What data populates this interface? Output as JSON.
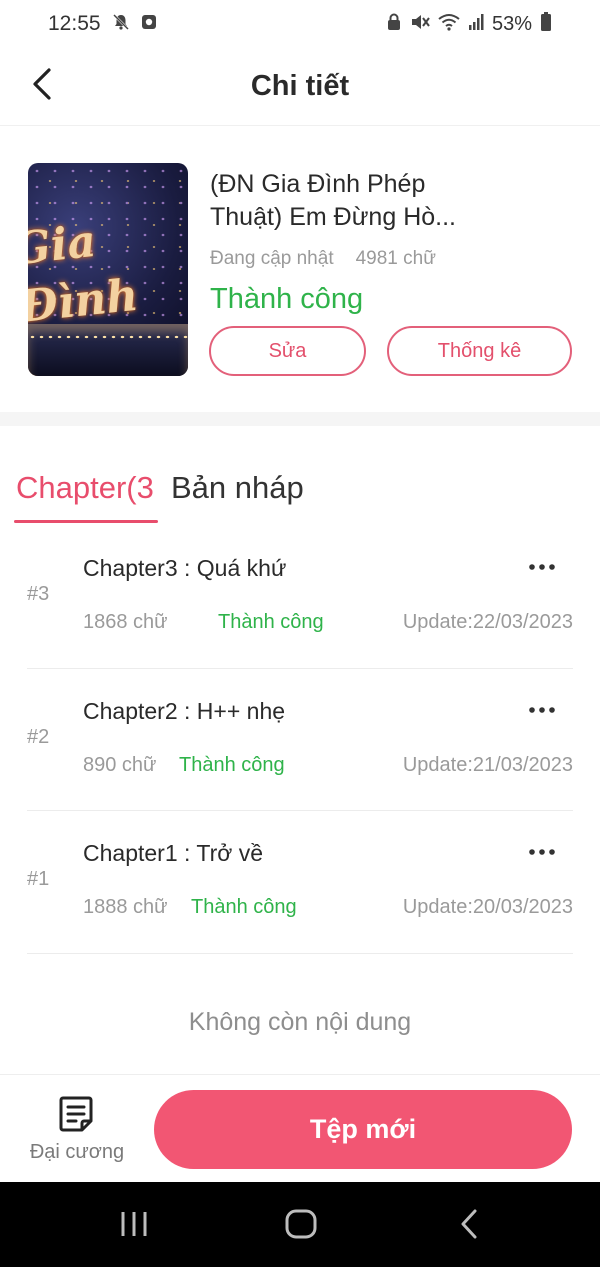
{
  "status_bar": {
    "time": "12:55",
    "battery_pct": "53%"
  },
  "header": {
    "title": "Chi tiết"
  },
  "book": {
    "title": "(ĐN Gia Đình Phép Thuật) Em Đừng Hò...",
    "update_status": "Đang cập nhật",
    "word_count": "4981 chữ",
    "publish_status": "Thành công",
    "edit_label": "Sửa",
    "stats_label": "Thống kê",
    "cover_text": "Gia Đình Phép Thuật"
  },
  "tabs": {
    "chapters_label": "Chapter(3",
    "drafts_label": "Bản nháp"
  },
  "chapters": [
    {
      "num": "#3",
      "title": "Chapter3 : Quá khứ",
      "words": "1868 chữ",
      "status": "Thành công",
      "update": "Update:22/03/2023"
    },
    {
      "num": "#2",
      "title": "Chapter2 : H++ nhẹ",
      "words": "890 chữ",
      "status": "Thành công",
      "update": "Update:21/03/2023"
    },
    {
      "num": "#1",
      "title": "Chapter1 : Trở về",
      "words": "1888 chữ",
      "status": "Thành công",
      "update": "Update:20/03/2023"
    }
  ],
  "end_text": "Không còn nội dung",
  "bottom": {
    "outline_label": "Đại cương",
    "new_label": "Tệp mới"
  },
  "colors": {
    "accent": "#e84d6c",
    "success": "#2fb34a",
    "primary_button": "#f25673"
  },
  "icons": {
    "back": "chevron-left-icon",
    "more": "more-horizontal-icon",
    "outline": "document-list-icon",
    "nav_recents": "recents-icon",
    "nav_home": "home-icon",
    "nav_back": "back-icon"
  }
}
